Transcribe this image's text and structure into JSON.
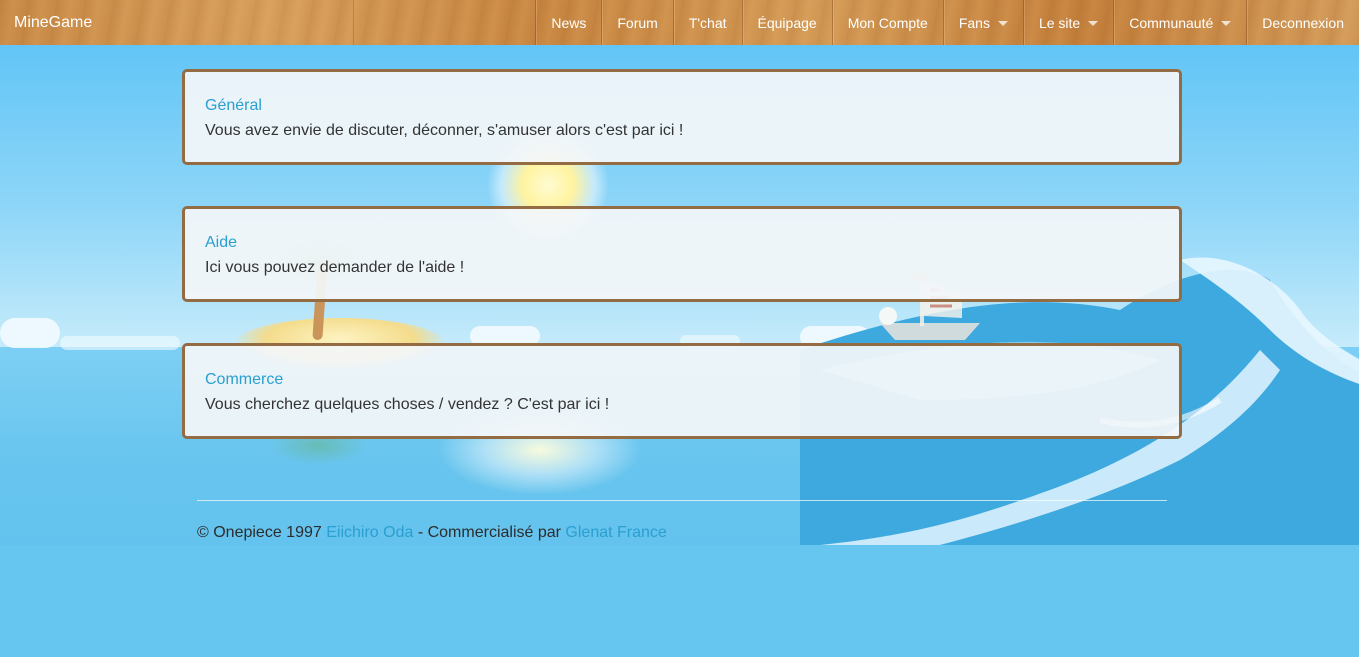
{
  "navbar": {
    "brand": "MineGame",
    "items": [
      {
        "label": "News",
        "dropdown": false
      },
      {
        "label": "Forum",
        "dropdown": false
      },
      {
        "label": "T'chat",
        "dropdown": false
      },
      {
        "label": "Équipage",
        "dropdown": false
      },
      {
        "label": "Mon Compte",
        "dropdown": false
      },
      {
        "label": "Fans",
        "dropdown": true
      },
      {
        "label": "Le site",
        "dropdown": true
      },
      {
        "label": "Communauté",
        "dropdown": true
      },
      {
        "label": "Deconnexion",
        "dropdown": false
      }
    ]
  },
  "forums": [
    {
      "title": "Général",
      "description": "Vous avez envie de discuter, déconner, s'amuser alors c'est par ici !"
    },
    {
      "title": "Aide",
      "description": "Ici vous pouvez demander de l'aide !"
    },
    {
      "title": "Commerce",
      "description": "Vous cherchez quelques choses / vendez ? C'est par ici !"
    }
  ],
  "footer": {
    "copyright": "© Onepiece 1997",
    "author_link": "Eiichiro Oda",
    "middle_text": "- Commercialisé par",
    "publisher_link": "Glenat France"
  },
  "colors": {
    "link": "#2a9fd0",
    "panel_border": "#946c44",
    "navbar_wood": "#c98a45",
    "background_sea": "#66c6ef"
  }
}
